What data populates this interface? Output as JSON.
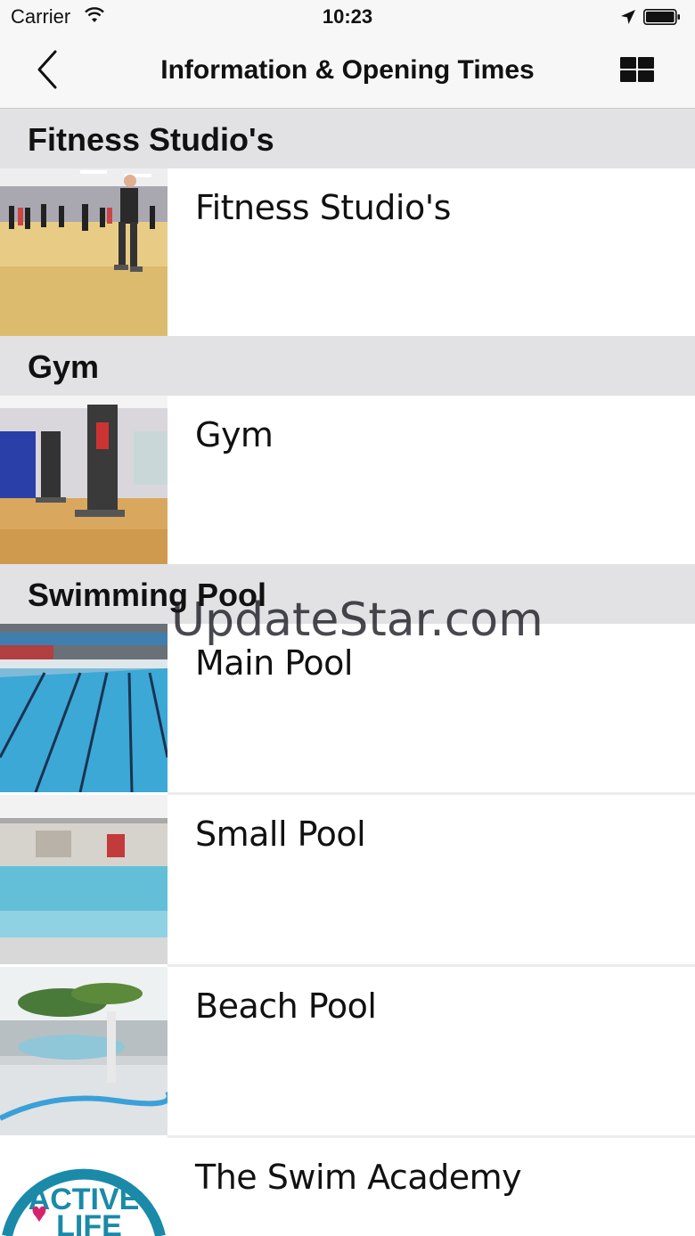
{
  "status_bar": {
    "carrier": "Carrier",
    "time": "10:23"
  },
  "nav": {
    "title": "Information & Opening Times",
    "back_icon": "chevron-left-icon",
    "menu_icon": "grid-icon"
  },
  "sections": [
    {
      "header": "Fitness Studio's",
      "items": [
        {
          "label": "Fitness Studio's"
        }
      ]
    },
    {
      "header": "Gym",
      "items": [
        {
          "label": "Gym"
        }
      ]
    },
    {
      "header": "Swimming Pool",
      "items": [
        {
          "label": "Main Pool"
        },
        {
          "label": "Small Pool"
        },
        {
          "label": "Beach Pool"
        },
        {
          "label": "The Swim Academy"
        }
      ]
    }
  ],
  "logo": {
    "line1": "ACTIVE",
    "line2": "LIFE"
  },
  "watermark": "UpdateStar.com",
  "colors": {
    "header_bg": "#e2e2e4",
    "nav_bg": "#f7f7f7",
    "logo_blue": "#1a8aa8",
    "logo_pink": "#d6246c"
  }
}
